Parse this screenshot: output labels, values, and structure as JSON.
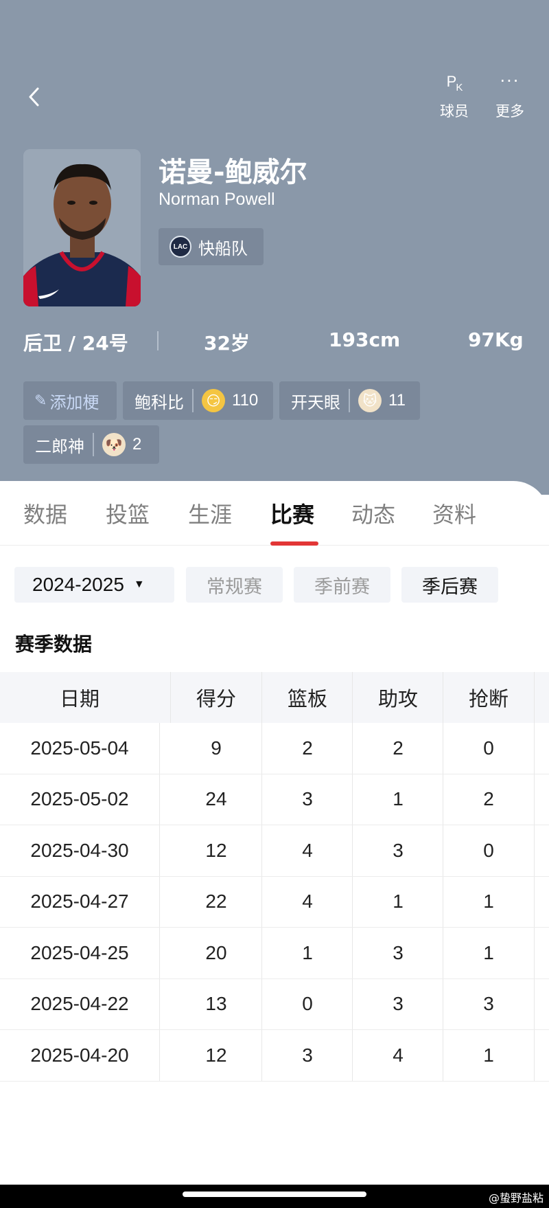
{
  "header": {
    "back_icon": "chevron-left-icon",
    "actions": [
      {
        "icon": "pk-icon",
        "icon_text": "P",
        "icon_sub": "K",
        "label": "球员"
      },
      {
        "icon": "more-icon",
        "icon_text": "···",
        "label": "更多"
      }
    ],
    "player": {
      "name_cn": "诺曼-鲍威尔",
      "name_en": "Norman Powell",
      "team": {
        "name": "快船队",
        "logo_text": "LAC"
      }
    },
    "info": {
      "position_number": "后卫 / 24号",
      "age": "32岁",
      "height": "193cm",
      "weight": "97Kg"
    },
    "tags": {
      "add_label": "添加梗",
      "items": [
        {
          "label": "鲍科比",
          "emoji": "😏",
          "count": "110"
        },
        {
          "label": "开天眼",
          "emoji": "🐱",
          "count": "11"
        },
        {
          "label": "二郎神",
          "emoji": "🐶",
          "count": "2"
        }
      ]
    }
  },
  "tabs": [
    {
      "label": "数据",
      "active": false
    },
    {
      "label": "投篮",
      "active": false
    },
    {
      "label": "生涯",
      "active": false
    },
    {
      "label": "比赛",
      "active": true
    },
    {
      "label": "动态",
      "active": false
    },
    {
      "label": "资料",
      "active": false
    }
  ],
  "filters": {
    "season": "2024-2025",
    "options": [
      {
        "label": "常规赛",
        "active": false
      },
      {
        "label": "季前赛",
        "active": false
      },
      {
        "label": "季后赛",
        "active": true
      }
    ]
  },
  "section_title": "赛季数据",
  "table": {
    "headers": [
      "日期",
      "得分",
      "篮板",
      "助攻",
      "抢断"
    ],
    "rows": [
      [
        "2025-05-04",
        "9",
        "2",
        "2",
        "0"
      ],
      [
        "2025-05-02",
        "24",
        "3",
        "1",
        "2"
      ],
      [
        "2025-04-30",
        "12",
        "4",
        "3",
        "0"
      ],
      [
        "2025-04-27",
        "22",
        "4",
        "1",
        "1"
      ],
      [
        "2025-04-25",
        "20",
        "1",
        "3",
        "1"
      ],
      [
        "2025-04-22",
        "13",
        "0",
        "3",
        "3"
      ],
      [
        "2025-04-20",
        "12",
        "3",
        "4",
        "1"
      ]
    ]
  },
  "watermark": "@蛰野盐粘",
  "colors": {
    "header_bg": "#8a98a9",
    "chip_bg": "#7b889a",
    "accent_red": "#e23636",
    "filter_bg": "#f2f4f8"
  }
}
